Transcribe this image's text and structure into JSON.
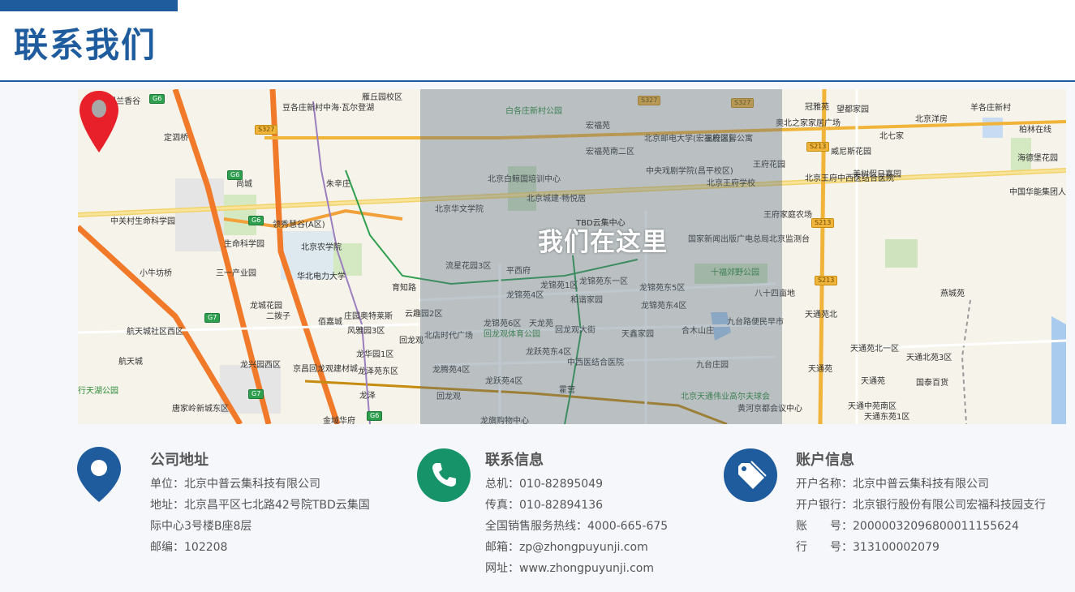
{
  "header": {
    "title": "联系我们"
  },
  "map": {
    "overlay_text": "我们在这里",
    "poi_label": "TBD云集中心",
    "labels": [
      "保利·罗兰香谷",
      "豆各庄新村",
      "中海·瓦尔登湖",
      "雁丘园校区",
      "白各庄新村公园",
      "宏福苑",
      "宏福苑南二区",
      "北京邮电大学(宏福校区)",
      "王府温馨公寓",
      "冠雅苑",
      "望都家园",
      "奥北之家家居广场",
      "北京洋房",
      "羊各庄新村",
      "柏林在线",
      "海德堡花园",
      "定泗桥",
      "尚城",
      "朱辛庄",
      "北京白鲸国培训中心",
      "中央戏剧学院(昌平校区)",
      "王府花园",
      "北京王府中西医结合医院",
      "美树假日嘉园",
      "威尼斯花园",
      "中关村生命科学园",
      "领秀慧谷(A区)",
      "北京农学院",
      "北京华文学院",
      "北京城建·畅悦居",
      "王府家庭农场",
      "中国华能集团人才创新创业基地",
      "生命科学园",
      "三一产业园",
      "小牛坊桥",
      "华北电力大学",
      "育知路",
      "流星花园3区",
      "平西府",
      "国家新闻出版广电总局北京监测台",
      "北京王府学校",
      "龙城花园",
      "云趣园2区",
      "庄园奥特莱斯",
      "佰嘉城",
      "风雅园3区",
      "龙锦苑1区",
      "龙锦苑东一区",
      "龙锦苑东5区",
      "龙锦苑4区",
      "和谐家园",
      "八十四亩地",
      "十福郊野公园",
      "航天城社区西区",
      "龙锦苑6区",
      "天龙苑",
      "龙锦苑东4区",
      "九台路便民早市",
      "天通苑北",
      "航天城",
      "龙兴园西区",
      "龙华园1区",
      "北店时代广场",
      "回龙观体育公园",
      "回龙观大街",
      "天鑫家园",
      "合木山庄",
      "京昌回龙观建材城",
      "龙泽苑东区",
      "龙跃苑东4区",
      "中西医结合医院",
      "九台庄园",
      "天通苑北一区",
      "天通北苑3区",
      "天通苑",
      "国泰百货",
      "行天湖公园",
      "龙腾苑4区",
      "龙跃苑4区",
      "霍营",
      "北京天通伟业高尔夫球会",
      "唐家岭新城东区",
      "龙泽",
      "回龙观",
      "黄河京都会议中心",
      "天通中苑南区",
      "天通东苑1区",
      "金域华府",
      "龙旗购物中心",
      "燕城苑",
      "北七家",
      "二拨子",
      "回龙观",
      "天通苑"
    ],
    "road_tags": [
      "G6",
      "S327",
      "S327",
      "S327",
      "S213",
      "S213",
      "S213",
      "G6",
      "G6",
      "G7",
      "G7",
      "G6"
    ]
  },
  "address": {
    "title": "公司地址",
    "lines": [
      "单位：北京中普云集科技有限公司",
      "地址：北京昌平区七北路42号院TBD云集国",
      "际中心3号楼B座8层",
      "邮编：102208"
    ]
  },
  "contact": {
    "title": "联系信息",
    "lines": [
      "总机：010-82895049",
      "传真：010-82894136",
      "全国销售服务热线：4000-665-675",
      "邮箱：zp@zhongpuyunji.com",
      "网址：www.zhongpuyunji.com"
    ]
  },
  "account": {
    "title": "账户信息",
    "lines": [
      "开户名称：北京中普云集科技有限公司",
      "开户银行：北京银行股份有限公司宏福科技园支行",
      "账　　号：20000032096800011155624",
      "行　　号：313100002079"
    ]
  },
  "colors": {
    "brand_blue": "#1f5c9e",
    "contact_green": "#17936a",
    "pin_red": "#e8202a"
  },
  "icons": {
    "address": "location-pin-icon",
    "contact": "phone-icon",
    "account": "tag-icon"
  }
}
